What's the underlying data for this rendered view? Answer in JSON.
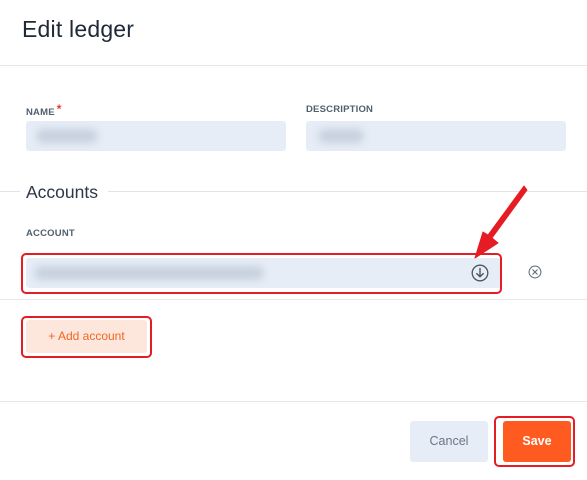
{
  "dialog": {
    "title": "Edit ledger"
  },
  "form": {
    "name_label": "NAME",
    "name_required_marker": "*",
    "description_label": "DESCRIPTION",
    "accounts_section_title": "Accounts",
    "account_label": "ACCOUNT",
    "add_account_label": "+ Add account"
  },
  "footer": {
    "cancel_label": "Cancel",
    "save_label": "Save"
  },
  "icons": {
    "dropdown": "chevron-down-circle-icon",
    "remove": "close-circle-icon",
    "annotation": "red-arrow-icon"
  },
  "colors": {
    "accent": "#ff5a1f",
    "annotation": "#e51c23",
    "input_bg": "#e6edf7",
    "add_bg": "#fde7dc"
  }
}
